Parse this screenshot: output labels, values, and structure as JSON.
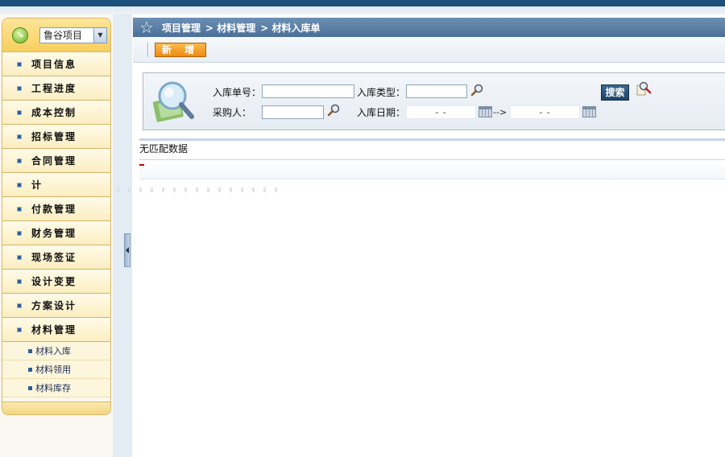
{
  "sidebar": {
    "project_select": "鲁谷项目",
    "menu": [
      {
        "label": "项目信息"
      },
      {
        "label": "工程进度"
      },
      {
        "label": "成本控制"
      },
      {
        "label": "招标管理"
      },
      {
        "label": "合同管理"
      },
      {
        "label": "计"
      },
      {
        "label": "付款管理"
      },
      {
        "label": "财务管理"
      },
      {
        "label": "现场签证"
      },
      {
        "label": "设计变更"
      },
      {
        "label": "方案设计"
      },
      {
        "label": "材料管理"
      }
    ],
    "submenu": [
      {
        "label": "材料入库"
      },
      {
        "label": "材料领用"
      },
      {
        "label": "材料库存"
      }
    ]
  },
  "breadcrumb": {
    "parts": [
      "项目管理",
      "> 材料管理",
      "> 材料入库单"
    ]
  },
  "toolbar": {
    "new_label": "新 增"
  },
  "search": {
    "order_no_label": "入库单号：",
    "order_no_value": "",
    "type_label": "入库类型：",
    "type_value": "",
    "buyer_label": "采购人：",
    "buyer_value": "",
    "date_label": "入库日期：",
    "date_from": "-   -",
    "date_sep": "-->",
    "date_to": "-   -",
    "search_label": "搜索"
  },
  "result": {
    "empty_text": "无匹配数据"
  },
  "colors": {
    "topbar": "#1d4f7d",
    "breadcrumb": "#5a7fa6",
    "new_button": "#f29a20",
    "search_button": "#2b5379",
    "sidebar_header": "#f9d76f"
  }
}
